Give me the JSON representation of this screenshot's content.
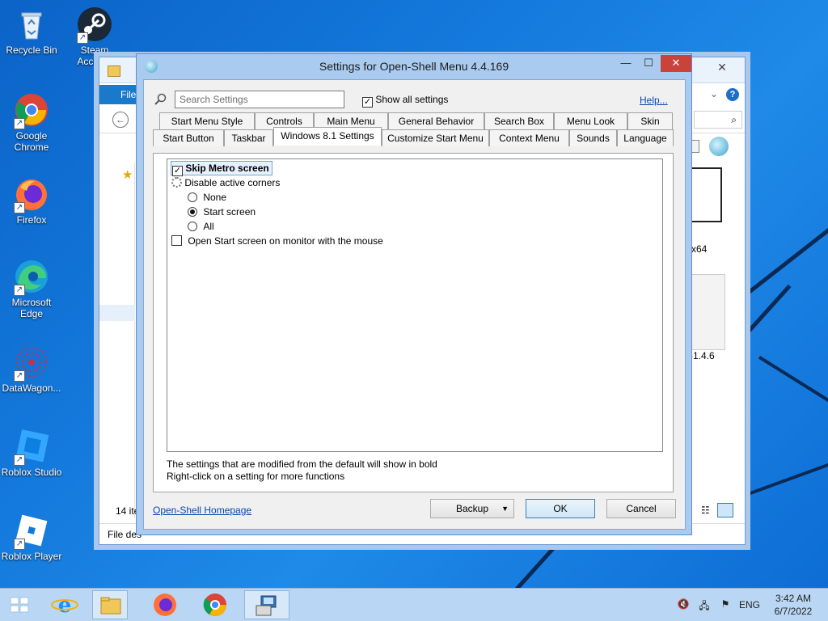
{
  "desktop": {
    "icons": [
      {
        "label": "Recycle Bin",
        "icon": "recycle-bin-icon"
      },
      {
        "label": "Steam\nAccou...",
        "icon": "steam-icon"
      },
      {
        "label": "Google\nChrome",
        "icon": "chrome-icon"
      },
      {
        "label": "Firefox",
        "icon": "firefox-icon"
      },
      {
        "label": "Microsoft\nEdge",
        "icon": "edge-icon"
      },
      {
        "label": "DataWagon...",
        "icon": "datawagon-icon"
      },
      {
        "label": "Roblox Studio",
        "icon": "roblox-studio-icon"
      },
      {
        "label": "Roblox Player",
        "icon": "roblox-player-icon"
      }
    ]
  },
  "explorer": {
    "file_tab": "File",
    "items_count": "14 ite",
    "status_left": "File des",
    "file_label_1": "x64",
    "file_label_2": "-1.4.6"
  },
  "dialog": {
    "title": "Settings for Open-Shell Menu 4.4.169",
    "minimize": "—",
    "maximize": "☐",
    "close": "✕",
    "search_placeholder": "Search Settings",
    "show_all_label": "Show all settings",
    "show_all_checked": true,
    "help_link": "Help...",
    "tabs_row1": [
      "Start Menu Style",
      "Controls",
      "Main Menu",
      "General Behavior",
      "Search Box",
      "Menu Look",
      "Skin"
    ],
    "tabs_row2": [
      "Start Button",
      "Taskbar",
      "Windows 8.1 Settings",
      "Customize Start Menu",
      "Context Menu",
      "Sounds",
      "Language"
    ],
    "active_tab": "Windows 8.1 Settings",
    "settings": {
      "skip_metro": {
        "label": "Skip Metro screen",
        "checked": true
      },
      "disable_corners": {
        "label": "Disable active corners"
      },
      "opt_none": {
        "label": "None",
        "selected": false
      },
      "opt_start": {
        "label": "Start screen",
        "selected": true
      },
      "opt_all": {
        "label": "All",
        "selected": false
      },
      "open_start": {
        "label": "Open Start screen on monitor with the mouse",
        "checked": false
      }
    },
    "hint_line1": "The settings that are modified from the default will show in bold",
    "hint_line2": "Right-click on a setting for more functions",
    "homepage_link": "Open-Shell Homepage",
    "backup_label": "Backup",
    "ok_label": "OK",
    "cancel_label": "Cancel"
  },
  "taskbar": {
    "language": "ENG",
    "time": "3:42 AM",
    "date": "6/7/2022"
  },
  "colors": {
    "desktop_blue": "#1479dc",
    "dialog_frame": "#aacbf0",
    "close_red": "#c9433a",
    "link_blue": "#0645ad",
    "taskbar": "#b9d7f4"
  }
}
